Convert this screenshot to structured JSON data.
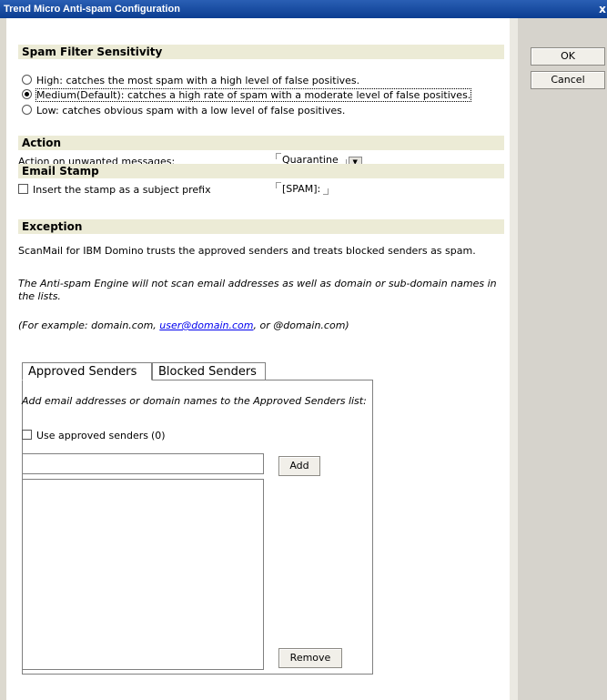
{
  "window": {
    "title": "Trend Micro Anti-spam Configuration",
    "close_glyph": "x"
  },
  "buttons": {
    "ok": "OK",
    "cancel": "Cancel",
    "add": "Add",
    "remove": "Remove"
  },
  "sensitivity": {
    "header": "Spam Filter Sensitivity",
    "options": [
      {
        "label": "High: catches the most spam with a high level of false positives.",
        "selected": false
      },
      {
        "label": "Medium(Default): catches a high rate of spam with a moderate level of false positives.",
        "selected": true
      },
      {
        "label": "Low: catches obvious spam with a low level of false positives.",
        "selected": false
      }
    ]
  },
  "action": {
    "header": "Action",
    "label": "Action on unwanted messages:",
    "value": "Quarantine"
  },
  "stamp": {
    "header": "Email Stamp",
    "checkbox_label": "Insert the stamp as a subject prefix",
    "checked": false,
    "value": "[SPAM]:"
  },
  "exception": {
    "header": "Exception",
    "intro": "ScanMail for IBM Domino trusts the approved senders and treats blocked senders as spam.",
    "note": "The Anti-spam Engine will not scan email addresses as well as domain or sub-domain names in the lists.",
    "example_prefix": "(For example: domain.com, ",
    "example_link": "user@domain.com",
    "example_suffix": ", or @domain.com)"
  },
  "tabs": {
    "approved": "Approved Senders",
    "blocked": "Blocked Senders",
    "active": "approved"
  },
  "approved_panel": {
    "instruction": "Add email addresses or domain names to the Approved Senders list:",
    "use_label": "Use approved senders",
    "count": "(0)",
    "use_checked": false,
    "input_value": "",
    "list_items": []
  },
  "colors": {
    "section_bg": "#ecebd6",
    "titlebar": "#0b3d91",
    "side_panel": "#d6d3cc"
  },
  "icons": {
    "close": "close-icon",
    "dropdown": "chevron-down-icon"
  }
}
